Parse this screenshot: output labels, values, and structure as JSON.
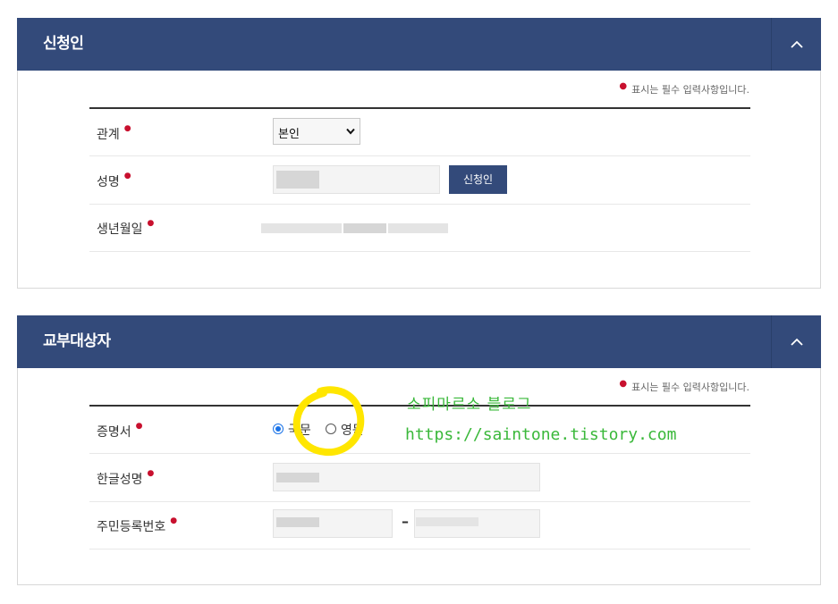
{
  "applicant": {
    "title": "신청인",
    "required_note": "표시는 필수 입력사항입니다.",
    "relation_label": "관계",
    "relation_value": "본인",
    "name_label": "성명",
    "applicant_button": "신청인",
    "birth_label": "생년월일"
  },
  "target": {
    "title": "교부대상자",
    "required_note": "표시는 필수 입력사항입니다.",
    "cert_label": "증명서",
    "cert_options": [
      "국문",
      "영문"
    ],
    "cert_selected": "국문",
    "korean_name_label": "한글성명",
    "rrn_label": "주민등록번호",
    "rrn_separator": "–"
  },
  "watermark": {
    "line1": "소피마르소 블로그",
    "line2": "https://saintone.tistory.com"
  },
  "colors": {
    "header": "#334a7a",
    "required_dot": "#c8102e",
    "highlight": "#ffe600",
    "watermark": "#3ab83a"
  }
}
